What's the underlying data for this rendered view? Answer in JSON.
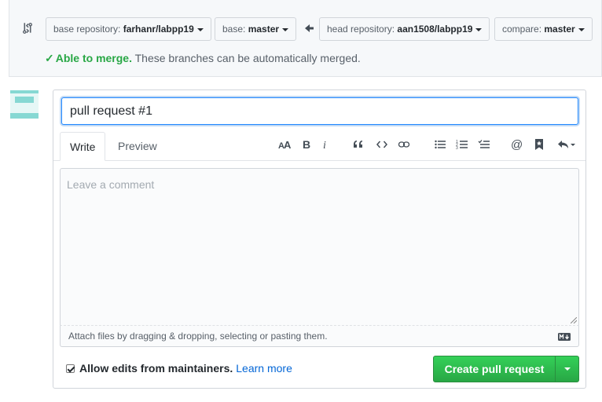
{
  "compare": {
    "base_repo_label": "base repository: ",
    "base_repo_value": "farhanr/labpp19",
    "base_label": "base: ",
    "base_value": "master",
    "head_repo_label": "head repository: ",
    "head_repo_value": "aan1508/labpp19",
    "compare_label": "compare: ",
    "compare_value": "master",
    "merge_ok": "Able to merge.",
    "merge_msg": " These branches can be automatically merged."
  },
  "form": {
    "title_value": "pull request #1",
    "tabs": [
      "Write",
      "Preview"
    ],
    "toolbar_icons": [
      "text-size-icon",
      "bold-icon",
      "italic-icon",
      "quote-icon",
      "code-icon",
      "link-icon",
      "unordered-list-icon",
      "ordered-list-icon",
      "task-list-icon",
      "mention-icon",
      "bookmark-icon",
      "reply-icon"
    ],
    "comment_placeholder": "Leave a comment",
    "attach_text": "Attach files by dragging & dropping, selecting or pasting them.",
    "allow_edits": "Allow edits from maintainers.",
    "learn_more": "Learn more",
    "submit_label": "Create pull request"
  },
  "colors": {
    "accent": "#28a745",
    "link": "#0366d6",
    "avatar": "#86d8d3"
  }
}
